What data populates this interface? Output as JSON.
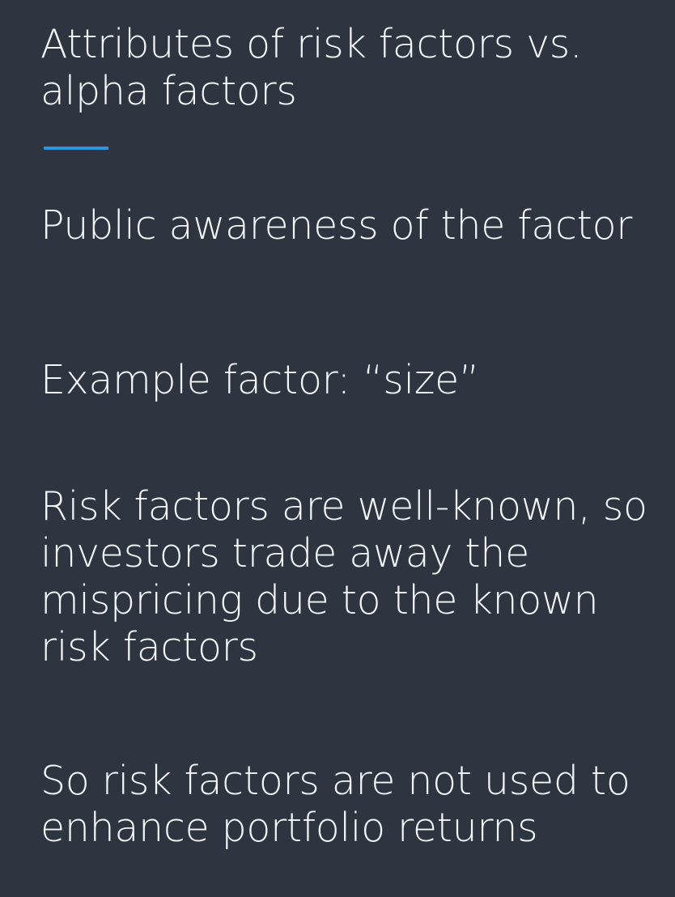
{
  "slide": {
    "title": "Attributes of risk factors vs. alpha factors",
    "accent_color": "#2c95de",
    "paragraphs": [
      "Public awareness of the factor",
      "Example factor: “size”",
      "Risk factors are well-known, so investors trade away the mispricing due to the known risk factors",
      "So risk factors are not used to enhance portfolio returns"
    ]
  }
}
